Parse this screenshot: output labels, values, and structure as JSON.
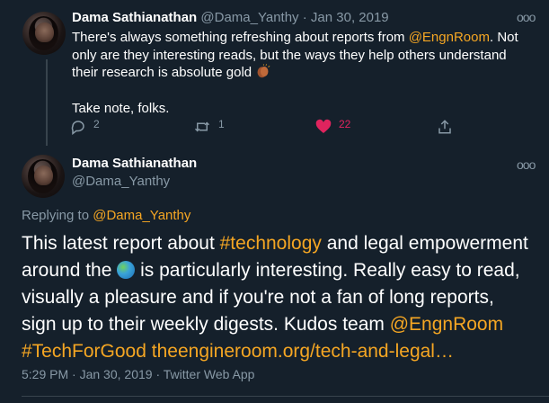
{
  "tweet1": {
    "name": "Dama Sathianathan",
    "handle": "@Dama_Yanthy",
    "separator": "·",
    "date": "Jan 30, 2019",
    "text_before_mention": "There's always something refreshing about reports from ",
    "mention": "@EngnRoom",
    "text_after_mention": ". Not only are they interesting reads, but the ways they help others understand their research is absolute gold ",
    "emoji": "clapping-hands",
    "paragraph2": "Take note, folks.",
    "replies": "2",
    "retweets": "1",
    "likes": "22"
  },
  "tweet2": {
    "name": "Dama Sathianathan",
    "handle": "@Dama_Yanthy",
    "replying_prefix": "Replying to ",
    "replying_handle": "@Dama_Yanthy",
    "text_1": "This latest report about ",
    "hashtag1": "#technology",
    "text_2": " and legal empowerment around the ",
    "emoji": "globe",
    "text_3": " is particularly interesting. Really easy to read, visually a pleasure and if you're not a fan of long reports, sign up to their weekly digests. Kudos team ",
    "mention": "@EngnRoom",
    "hashtag2": "#TechForGood",
    "link": "theengineroom.org/tech-and-legal…",
    "time": "5:29 PM",
    "separator1": "·",
    "date": "Jan 30, 2019",
    "separator2": "·",
    "source": "Twitter Web App"
  },
  "colors": {
    "background": "#15202b",
    "text": "#ffffff",
    "muted": "#8899a6",
    "accent": "#f5a623",
    "like": "#e0245e",
    "divider": "#38444d"
  },
  "icons": {
    "reply": "reply-icon",
    "retweet": "retweet-icon",
    "like": "heart-icon",
    "share": "share-icon",
    "more": "more-icon"
  },
  "more_glyph": "ooo"
}
